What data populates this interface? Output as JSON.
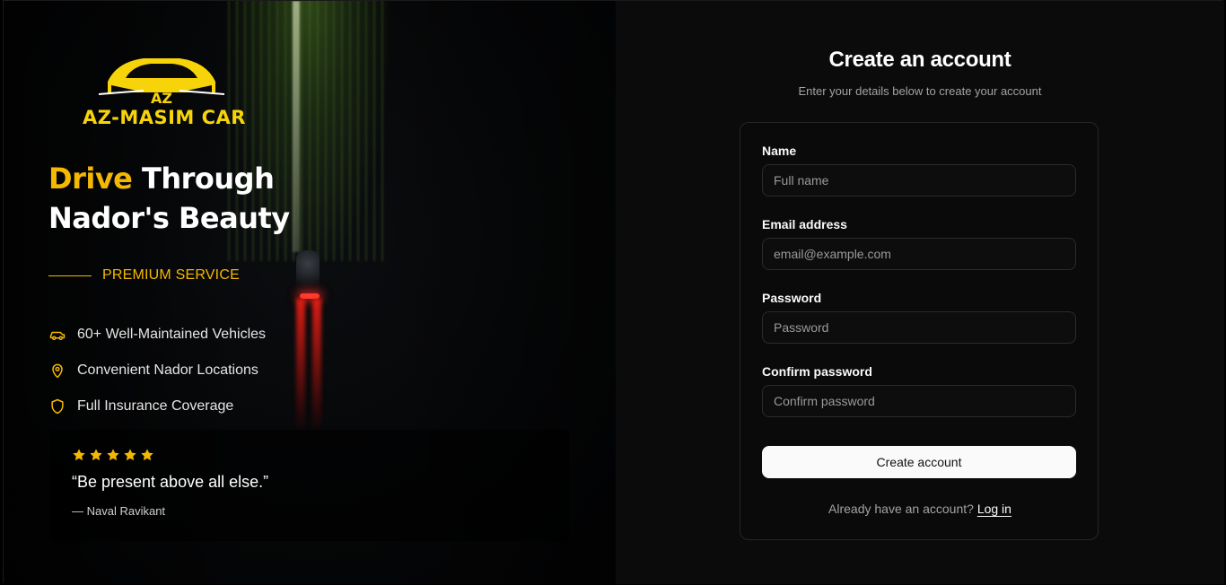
{
  "brand": {
    "name": "AZ-MASIM CAR",
    "monogram": "AZ",
    "accent_color": "#f5b800"
  },
  "hero": {
    "headline_accent": "Drive",
    "headline_rest_1": "Through",
    "headline_line_2": "Nador's Beauty",
    "premium_label": "PREMIUM SERVICE",
    "features": [
      {
        "icon": "car-icon",
        "label": "60+ Well-Maintained Vehicles"
      },
      {
        "icon": "map-pin-icon",
        "label": "Convenient Nador Locations"
      },
      {
        "icon": "shield-icon",
        "label": "Full Insurance Coverage"
      }
    ],
    "testimonial": {
      "rating": 5,
      "quote": "“Be present above all else.”",
      "author": "— Naval Ravikant"
    }
  },
  "form": {
    "title": "Create an account",
    "subtitle": "Enter your details below to create your account",
    "fields": {
      "name": {
        "label": "Name",
        "placeholder": "Full name"
      },
      "email": {
        "label": "Email address",
        "placeholder": "email@example.com"
      },
      "password": {
        "label": "Password",
        "placeholder": "Password"
      },
      "confirm": {
        "label": "Confirm password",
        "placeholder": "Confirm password"
      }
    },
    "submit_label": "Create account",
    "footer_text": "Already have an account?",
    "login_link": "Log in"
  }
}
